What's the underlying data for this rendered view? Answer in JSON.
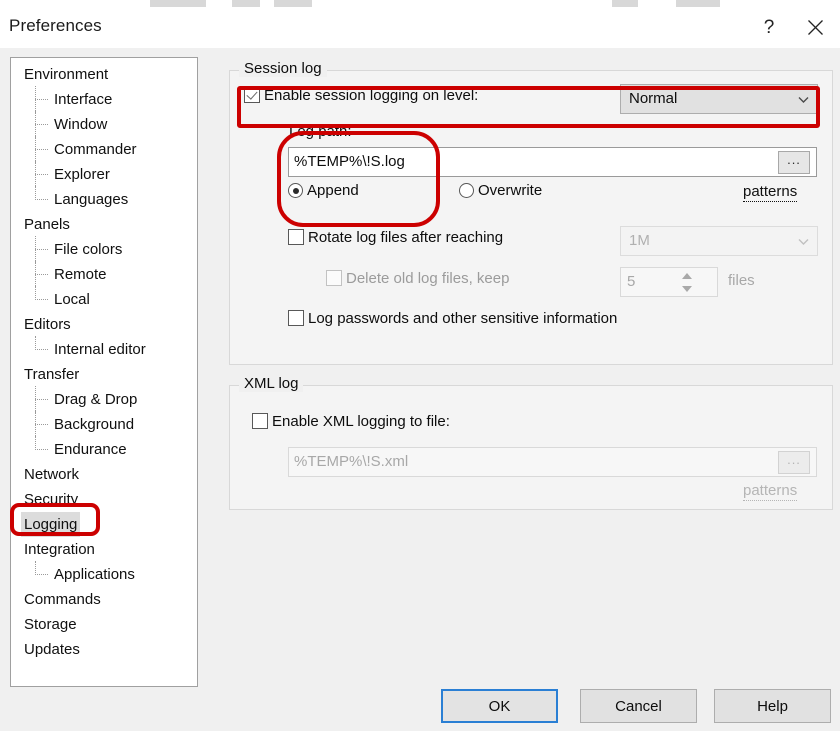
{
  "window": {
    "title": "Preferences",
    "help_icon": "question-mark-icon",
    "close_icon": "close-icon"
  },
  "sidebar": {
    "items": [
      {
        "label": "Environment",
        "level": 0,
        "selected": false,
        "last": false
      },
      {
        "label": "Interface",
        "level": 1,
        "selected": false,
        "last": false
      },
      {
        "label": "Window",
        "level": 1,
        "selected": false,
        "last": false
      },
      {
        "label": "Commander",
        "level": 1,
        "selected": false,
        "last": false
      },
      {
        "label": "Explorer",
        "level": 1,
        "selected": false,
        "last": false
      },
      {
        "label": "Languages",
        "level": 1,
        "selected": false,
        "last": true
      },
      {
        "label": "Panels",
        "level": 0,
        "selected": false,
        "last": false
      },
      {
        "label": "File colors",
        "level": 1,
        "selected": false,
        "last": false
      },
      {
        "label": "Remote",
        "level": 1,
        "selected": false,
        "last": false
      },
      {
        "label": "Local",
        "level": 1,
        "selected": false,
        "last": true
      },
      {
        "label": "Editors",
        "level": 0,
        "selected": false,
        "last": false
      },
      {
        "label": "Internal editor",
        "level": 1,
        "selected": false,
        "last": true
      },
      {
        "label": "Transfer",
        "level": 0,
        "selected": false,
        "last": false
      },
      {
        "label": "Drag & Drop",
        "level": 1,
        "selected": false,
        "last": false
      },
      {
        "label": "Background",
        "level": 1,
        "selected": false,
        "last": false
      },
      {
        "label": "Endurance",
        "level": 1,
        "selected": false,
        "last": true
      },
      {
        "label": "Network",
        "level": 0,
        "selected": false,
        "last": false
      },
      {
        "label": "Security",
        "level": 0,
        "selected": false,
        "last": false
      },
      {
        "label": "Logging",
        "level": 0,
        "selected": true,
        "last": false
      },
      {
        "label": "Integration",
        "level": 0,
        "selected": false,
        "last": false
      },
      {
        "label": "Applications",
        "level": 1,
        "selected": false,
        "last": true
      },
      {
        "label": "Commands",
        "level": 0,
        "selected": false,
        "last": false
      },
      {
        "label": "Storage",
        "level": 0,
        "selected": false,
        "last": false
      },
      {
        "label": "Updates",
        "level": 0,
        "selected": false,
        "last": false
      }
    ]
  },
  "session_log": {
    "group_title": "Session log",
    "enable_label": "Enable session logging on level:",
    "enable_checked": true,
    "level_value": "Normal",
    "log_path_label": "Log path:",
    "log_path_value": "%TEMP%\\!S.log",
    "browse_label": "...",
    "patterns_label": "patterns",
    "append_label": "Append",
    "overwrite_label": "Overwrite",
    "write_mode": "Append",
    "rotate_label": "Rotate log files after reaching",
    "rotate_checked": false,
    "rotate_size": "1M",
    "delete_old_label": "Delete old log files, keep",
    "delete_old_checked": false,
    "keep_count": "5",
    "files_label": "files",
    "log_passwords_label": "Log passwords and other sensitive information",
    "log_passwords_checked": false
  },
  "xml_log": {
    "group_title": "XML log",
    "enable_label": "Enable XML logging to file:",
    "enable_checked": false,
    "file_value": "%TEMP%\\!S.xml",
    "browse_label": "...",
    "patterns_label": "patterns"
  },
  "buttons": {
    "ok": "OK",
    "cancel": "Cancel",
    "help": "Help"
  },
  "annotations": {
    "accent_color": "#cc0000",
    "focus_color": "#2a7fd4"
  }
}
